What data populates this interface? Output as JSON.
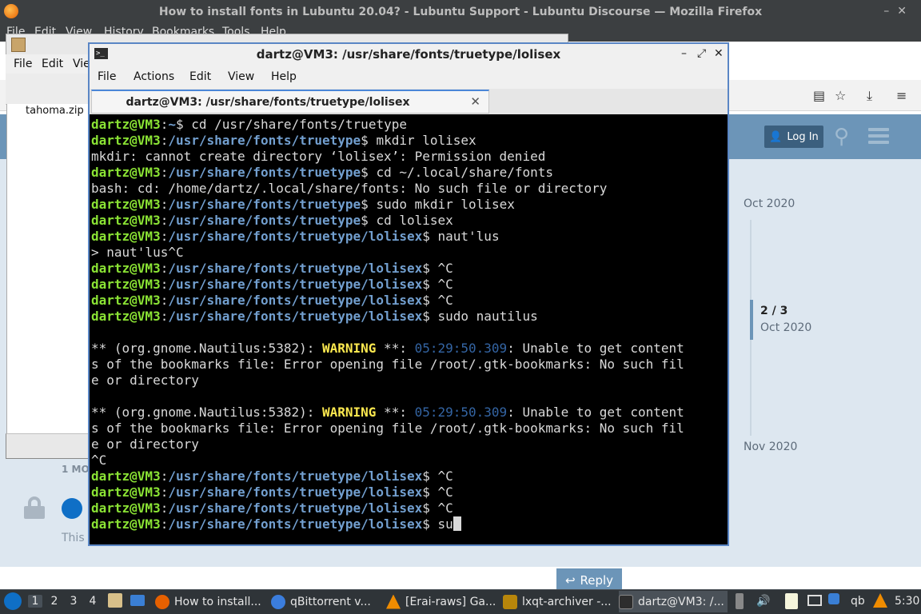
{
  "firefox": {
    "title": "How to install fonts in Lubuntu 20.04? - Lubuntu Support - Lubuntu Discourse — Mozilla Firefox",
    "menu": [
      "File",
      "Edit",
      "View",
      "History",
      "Bookmarks",
      "Tools",
      "Help"
    ]
  },
  "discourse": {
    "login_label": "Log In",
    "timeline_top": "Oct 2020",
    "timeline_position": "2 / 3",
    "timeline_position_date": "Oct 2020",
    "timeline_bottom": "Nov 2020",
    "post_age": "1 MO",
    "post_excerpt": "This",
    "reply_label": "Reply"
  },
  "archiver": {
    "menu": [
      "File",
      "Edit",
      "View"
    ],
    "file": "tahoma.zip"
  },
  "terminal": {
    "title": "dartz@VM3: /usr/share/fonts/truetype/lolisex",
    "menu": [
      "File",
      "Actions",
      "Edit",
      "View",
      "Help"
    ],
    "tab_label": "dartz@VM3: /usr/share/fonts/truetype/lolisex",
    "user": "dartz@VM3",
    "lines": [
      {
        "path": "~",
        "cmd": " cd /usr/share/fonts/truetype"
      },
      {
        "path": "/usr/share/fonts/truetype",
        "cmd": " mkdir lolisex"
      },
      {
        "text": "mkdir: cannot create directory ‘lolisex’: Permission denied"
      },
      {
        "path": "/usr/share/fonts/truetype",
        "cmd": " cd ~/.local/share/fonts"
      },
      {
        "text": "bash: cd: /home/dartz/.local/share/fonts: No such file or directory"
      },
      {
        "path": "/usr/share/fonts/truetype",
        "cmd": " sudo mkdir lolisex"
      },
      {
        "path": "/usr/share/fonts/truetype",
        "cmd": " cd lolisex"
      },
      {
        "path": "/usr/share/fonts/truetype/lolisex",
        "cmd": " naut'lus"
      },
      {
        "text": "> naut'lus^C"
      },
      {
        "path": "/usr/share/fonts/truetype/lolisex",
        "cmd": " ^C"
      },
      {
        "path": "/usr/share/fonts/truetype/lolisex",
        "cmd": " ^C"
      },
      {
        "path": "/usr/share/fonts/truetype/lolisex",
        "cmd": " ^C"
      },
      {
        "path": "/usr/share/fonts/truetype/lolisex",
        "cmd": " sudo nautilus"
      },
      {
        "text": ""
      },
      {
        "warn": true,
        "pre": "** (org.gnome.Nautilus:5382): ",
        "w": "WARNING",
        "mid": " **: ",
        "time": "05:29:50.309",
        "post": ": Unable to get content"
      },
      {
        "text": "s of the bookmarks file: Error opening file /root/.gtk-bookmarks: No such fil"
      },
      {
        "text": "e or directory"
      },
      {
        "text": ""
      },
      {
        "warn": true,
        "pre": "** (org.gnome.Nautilus:5382): ",
        "w": "WARNING",
        "mid": " **: ",
        "time": "05:29:50.309",
        "post": ": Unable to get content"
      },
      {
        "text": "s of the bookmarks file: Error opening file /root/.gtk-bookmarks: No such fil"
      },
      {
        "text": "e or directory"
      },
      {
        "text": "^C"
      },
      {
        "path": "/usr/share/fonts/truetype/lolisex",
        "cmd": " ^C"
      },
      {
        "path": "/usr/share/fonts/truetype/lolisex",
        "cmd": " ^C"
      },
      {
        "path": "/usr/share/fonts/truetype/lolisex",
        "cmd": " ^C"
      },
      {
        "path": "/usr/share/fonts/truetype/lolisex",
        "cmd": " su",
        "cursor": true
      }
    ]
  },
  "taskbar": {
    "workspaces": [
      "1",
      "2",
      "3",
      "4"
    ],
    "tasks": [
      {
        "label": "How to install...",
        "color": "#e66000"
      },
      {
        "label": "qBittorrent v...",
        "color": "#3b7ddd"
      },
      {
        "label": "[Erai-raws] Ga...",
        "color": "#f08c00"
      },
      {
        "label": "lxqt-archiver -...",
        "color": "#b8860b"
      },
      {
        "label": "dartz@VM3: /...",
        "color": "#2d2d2d"
      }
    ],
    "tray_qb": "qb",
    "clock": "5:30"
  }
}
